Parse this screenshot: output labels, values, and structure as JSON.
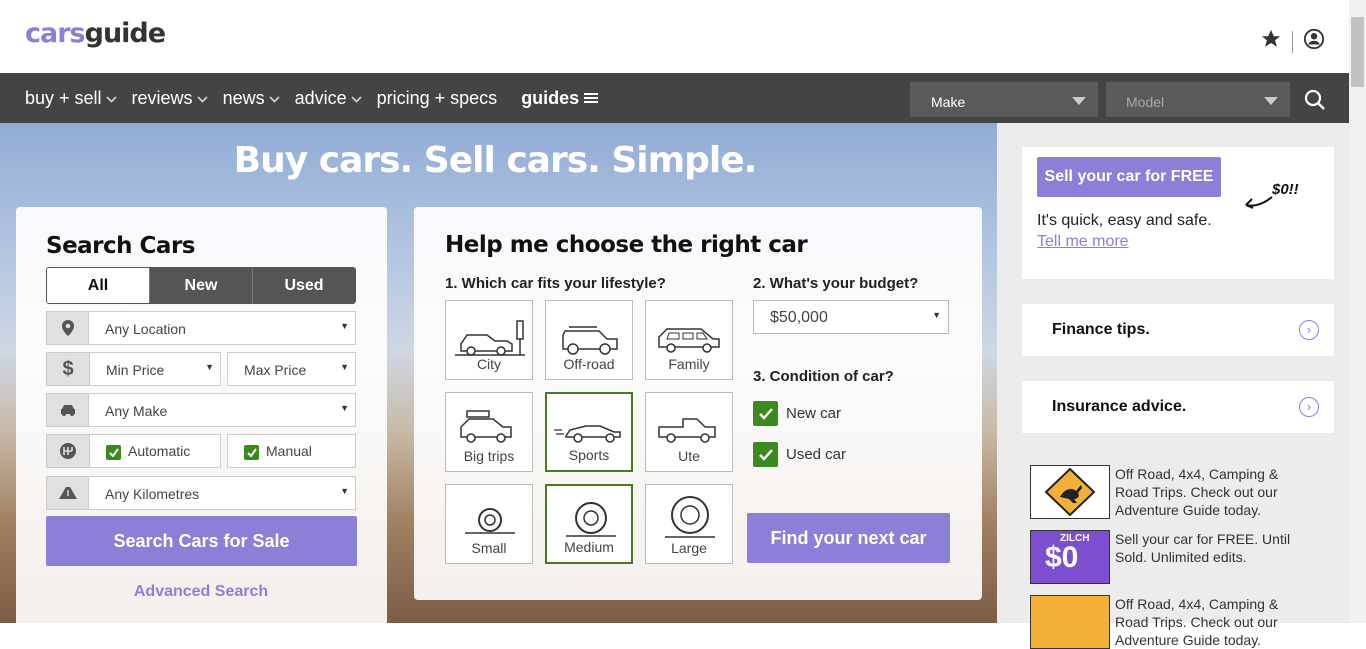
{
  "header": {
    "logo_cars": "cars",
    "logo_guide": "guide"
  },
  "nav": {
    "items": [
      "buy + sell",
      "reviews",
      "news",
      "advice"
    ],
    "pricing": "pricing + specs",
    "guides": "guides",
    "make": "Make",
    "model": "Model"
  },
  "hero": {
    "title": "Buy cars. Sell cars. Simple."
  },
  "search": {
    "title": "Search Cars",
    "tabs": [
      "All",
      "New",
      "Used"
    ],
    "location": "Any Location",
    "min_price": "Min Price",
    "max_price": "Max Price",
    "make": "Any Make",
    "automatic": "Automatic",
    "manual": "Manual",
    "kms": "Any Kilometres",
    "button": "Search Cars for Sale",
    "advanced": "Advanced Search"
  },
  "help": {
    "title": "Help me choose the right car",
    "q1": "1. Which car fits your lifestyle?",
    "q2": "2. What's your budget?",
    "q3": "3. Condition of car?",
    "tiles": [
      "City",
      "Off-road",
      "Family",
      "Big trips",
      "Sports",
      "Ute",
      "Small",
      "Medium",
      "Large"
    ],
    "selected": [
      "Sports",
      "Medium"
    ],
    "budget": "$50,000",
    "new_car": "New car",
    "used_car": "Used car",
    "button": "Find your next car"
  },
  "sidebar": {
    "sell_button": "Sell your car for FREE",
    "sell_sub": "It's quick, easy and safe.",
    "sell_link": "Tell me more",
    "sell_scribble": "$0!!",
    "finance": "Finance tips.",
    "insurance": "Insurance advice.",
    "promos": [
      {
        "text": "Off Road, 4x4, Camping & Road Trips. Check out our Adventure Guide today."
      },
      {
        "text": "Sell your car for FREE. Until Sold. Unlimited edits.",
        "badge": "$0",
        "badge_top": "ZILCH"
      },
      {
        "text": "Off Road, 4x4, Camping & Road Trips. Check out our Adventure Guide today."
      }
    ]
  },
  "colors": {
    "accent": "#8c7fd8",
    "nav": "#444444",
    "check": "#3c8a1e"
  }
}
